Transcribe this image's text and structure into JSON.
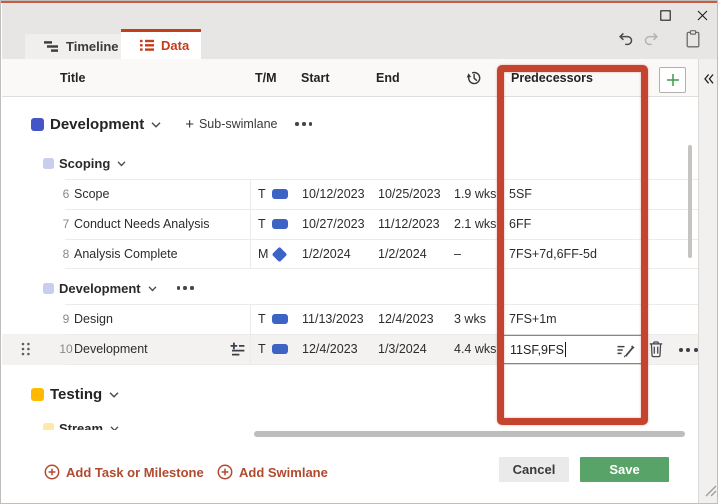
{
  "window": {
    "controls": {
      "maximize": "maximize",
      "close": "close"
    },
    "accent_color": "#CB5A44"
  },
  "tabs": [
    {
      "id": "timeline",
      "label": "Timeline",
      "active": false,
      "icon": "timeline-icon"
    },
    {
      "id": "data",
      "label": "Data",
      "active": true,
      "icon": "list-icon",
      "accent_color": "#C43E1C"
    }
  ],
  "quick_actions": {
    "undo": "undo",
    "redo": "redo",
    "clipboard": "clipboard"
  },
  "table": {
    "headers": {
      "title": "Title",
      "tm": "T/M",
      "start": "Start",
      "end": "End",
      "duration_icon": "duration-history-clock",
      "predecessors": "Predecessors"
    },
    "add_column_label": "+",
    "add_column_color": "#3E9B51",
    "collapse_pane_icon": "double-chevron-left"
  },
  "content": {
    "items": [
      {
        "type": "swimlane",
        "label": "Development",
        "color": "#4456C6",
        "add_sub_label": "Sub-swimlane",
        "has_menu": true
      },
      {
        "type": "subswimlane",
        "label": "Scoping",
        "color": "#C9CEEF",
        "has_menu": false
      },
      {
        "type": "task",
        "num": "6",
        "title": "Scope",
        "tm": "T",
        "shape": "bar",
        "start": "10/12/2023",
        "end": "10/25/2023",
        "duration": "1.9 wks",
        "predecessors": "5SF"
      },
      {
        "type": "task",
        "num": "7",
        "title": "Conduct Needs Analysis",
        "tm": "T",
        "shape": "bar",
        "start": "10/27/2023",
        "end": "11/12/2023",
        "duration": "2.1 wks",
        "predecessors": "6FF",
        "block_end": false
      },
      {
        "type": "task",
        "num": "8",
        "title": "Analysis Complete",
        "tm": "M",
        "shape": "diamond",
        "start": "1/2/2024",
        "end": "1/2/2024",
        "duration": "–",
        "predecessors": "7FS+7d,6FF-5d",
        "block_end": true
      },
      {
        "type": "subswimlane",
        "label": "Development",
        "color": "#C9CEEF",
        "has_menu": true
      },
      {
        "type": "task",
        "num": "9",
        "title": "Design",
        "tm": "T",
        "shape": "bar",
        "start": "11/13/2023",
        "end": "12/4/2023",
        "duration": "3 wks",
        "predecessors": "7FS+1m"
      },
      {
        "type": "task",
        "num": "10",
        "title": "Development",
        "tm": "T",
        "shape": "bar",
        "start": "12/4/2023",
        "end": "1/3/2024",
        "duration": "4.4 wks",
        "selected": true,
        "block_end": true,
        "details_icon": true,
        "drag_handle": true,
        "pred_input_value": "11SF,9FS",
        "edit_icon": "rename-edit",
        "trash_icon": "delete-trash",
        "menu_icon": "more-dots"
      },
      {
        "type": "swimlane",
        "label": "Testing",
        "color": "#FFB900",
        "has_menu": false
      },
      {
        "type": "subswimlane",
        "label": "Stream",
        "color": "#FFE9A9",
        "has_menu": false
      }
    ]
  },
  "scrollbars": {
    "vertical": "vertical-scrollbar",
    "horizontal": "horizontal-scrollbar"
  },
  "footer": {
    "add_task_label": "Add Task or Milestone",
    "add_swimlane_label": "Add Swimlane",
    "action_color": "#B04A2F",
    "cancel_label": "Cancel",
    "save_label": "Save",
    "save_color": "#57A368"
  },
  "annotation": {
    "name": "predecessors-column-highlight",
    "color": "#C4442F"
  }
}
